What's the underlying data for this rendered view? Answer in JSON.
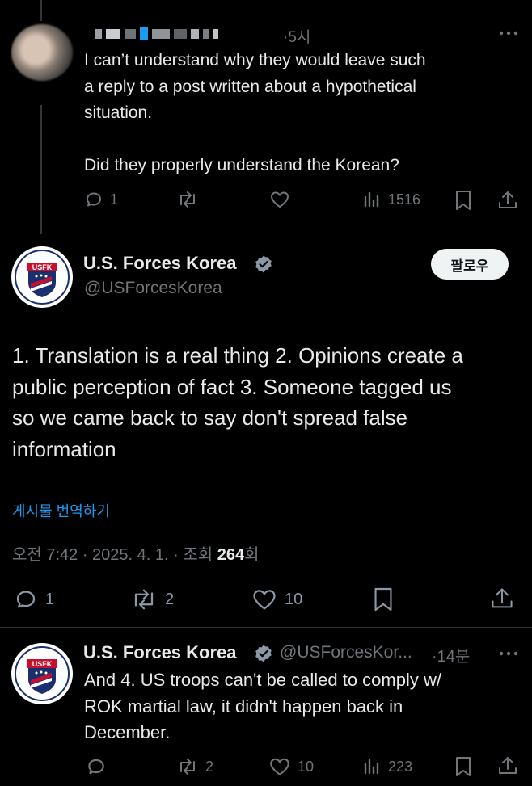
{
  "reply1": {
    "time": "·5시",
    "text_lines": [
      "I can’t understand why they would leave such",
      "a reply to a post written about a hypothetical",
      "situation."
    ],
    "text_line4": "Did they properly understand the Korean?",
    "replies": "1",
    "views": "1516"
  },
  "main": {
    "display_name": "U.S. Forces Korea",
    "handle": "@USForcesKorea",
    "follow_label": "팔로우",
    "body_lines": [
      "1. Translation is a real thing 2. Opinions create a",
      "public perception of fact 3. Someone tagged us",
      "so we came back to say don't spread false",
      "information"
    ],
    "translate_label": "게시물 번역하기",
    "meta_prefix": "오전 7:42 · 2025. 4. 1. · 조회 ",
    "meta_views": "264",
    "meta_suffix": "회",
    "replies": "1",
    "reposts": "2",
    "likes": "10",
    "logo_text": "USFK"
  },
  "reply2": {
    "display_name": "U.S. Forces Korea",
    "handle": "@USForcesKor...",
    "time": "·14분",
    "text_lines": [
      "And 4. US troops can't be called to comply w/",
      "ROK martial law, it didn't happen back in",
      "December."
    ],
    "reposts": "2",
    "likes": "10",
    "views": "223",
    "logo_text": "USFK"
  },
  "colors": {
    "verified": "#8b98a5",
    "link": "#1d9bf0",
    "background": "#000000"
  }
}
